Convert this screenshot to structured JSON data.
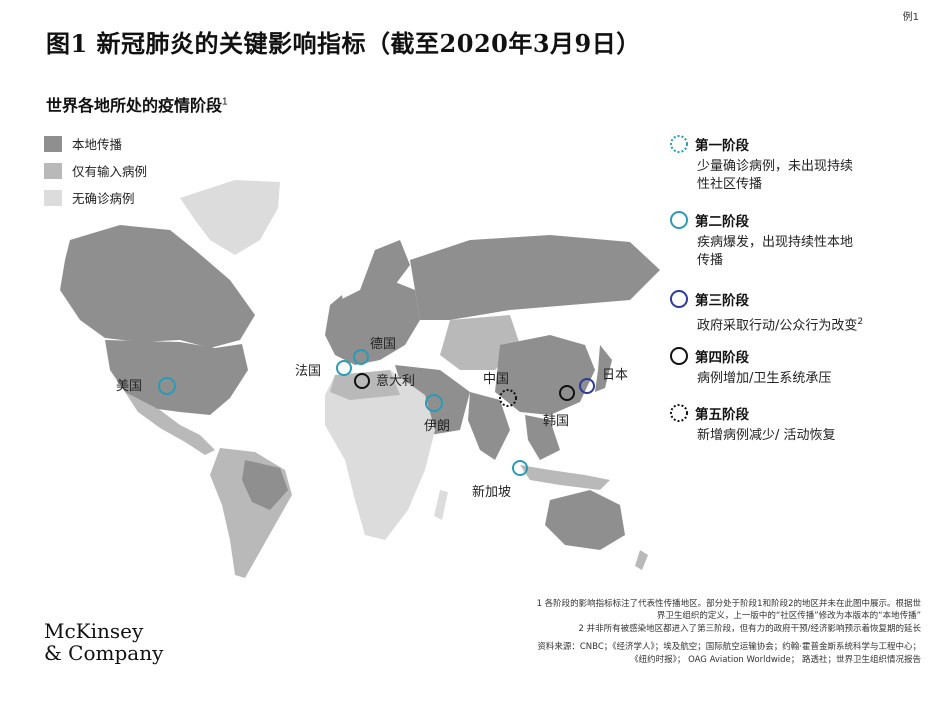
{
  "exhibit_tag": "例1",
  "title": "图1 新冠肺炎的关键影响指标（截至2020年3月9日）",
  "subtitle": "世界各地所处的疫情阶段",
  "subtitle_sup": "1",
  "legend": [
    {
      "label": "本地传播",
      "color": "#8f8f8f"
    },
    {
      "label": "仅有输入病例",
      "color": "#b9b9b9"
    },
    {
      "label": "无确诊病例",
      "color": "#dcdcdc"
    }
  ],
  "phases": [
    {
      "name": "第一阶段",
      "desc": "少量确诊病例，未出现持续性社区传播",
      "desc_lines": [
        "少量确诊病例，未出现持续",
        "性社区传播"
      ],
      "color": "#2a9bb5",
      "style": "dotted"
    },
    {
      "name": "第二阶段",
      "desc": "疾病爆发，出现持续性本地传播",
      "desc_lines": [
        "疾病爆发，出现持续性本地",
        "传播"
      ],
      "color": "#2a9bb5",
      "style": "solid"
    },
    {
      "name": "第三阶段",
      "desc": "政府采取行动/公众行为改变",
      "desc_lines": [
        "政府采取行动/公众行为改变"
      ],
      "sup": "2",
      "color": "#2d3b9a",
      "style": "solid"
    },
    {
      "name": "第四阶段",
      "desc": "病例增加/卫生系统承压",
      "desc_lines": [
        "病例增加/卫生系统承压"
      ],
      "color": "#111111",
      "style": "solid"
    },
    {
      "name": "第五阶段",
      "desc": "新增病例减少/ 活动恢复",
      "desc_lines": [
        "新增病例减少/ 活动恢复"
      ],
      "color": "#111111",
      "style": "dotted"
    }
  ],
  "map_labels": {
    "usa": "美国",
    "germany": "德国",
    "france": "法国",
    "italy": "意大利",
    "china": "中国",
    "japan": "日本",
    "korea": "韩国",
    "iran": "伊朗",
    "singapore": "新加坡"
  },
  "markers": [
    {
      "place": "usa",
      "phase": 2
    },
    {
      "place": "germany",
      "phase": 2
    },
    {
      "place": "france",
      "phase": 2
    },
    {
      "place": "italy",
      "phase": 4
    },
    {
      "place": "iran",
      "phase": 2
    },
    {
      "place": "china",
      "phase": 5
    },
    {
      "place": "korea",
      "phase": 4
    },
    {
      "place": "japan",
      "phase": 3
    },
    {
      "place": "singapore",
      "phase": 2
    }
  ],
  "footnotes": {
    "note1_line1": "1 各阶段的影响指标标注了代表性传播地区。部分处于阶段1和阶段2的地区并未在此图中展示。根据世",
    "note1_line2": "界卫生组织的定义，上一版中的“社区传播”修改为本版本的“本地传播”",
    "note2": "2 并非所有被感染地区都进入了第三阶段，但有力的政府干预/经济影响预示着恢复期的延长",
    "source_line1": "资料来源：CNBC；《经济学人》；埃及航空；国际航空运输协会；约翰·霍普金斯系统科学与工程中心；",
    "source_line2": "《纽约时报》； OAG Aviation Worldwide； 路透社；世界卫生组织情况报告"
  },
  "logo": {
    "line1": "McKinsey",
    "line2": "& Company"
  }
}
